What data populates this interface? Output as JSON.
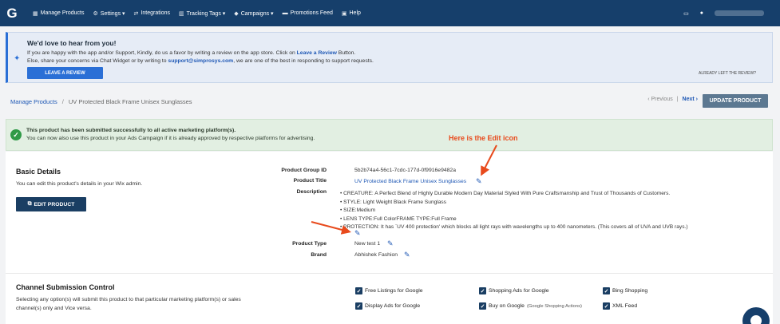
{
  "nav": {
    "logo": "G",
    "items": [
      {
        "label": "Manage Products",
        "icon": "grid-icon",
        "glyph": "▦"
      },
      {
        "label": "Settings ▾",
        "icon": "gear-icon",
        "glyph": "⚙"
      },
      {
        "label": "Integrations",
        "icon": "integration-icon",
        "glyph": "⇄"
      },
      {
        "label": "Tracking Tags ▾",
        "icon": "chart-icon",
        "glyph": "▥"
      },
      {
        "label": "Campaigns ▾",
        "icon": "tag-icon",
        "glyph": "◆"
      },
      {
        "label": "Promotions Feed",
        "icon": "ticket-icon",
        "glyph": "▬"
      },
      {
        "label": "Help",
        "icon": "help-icon",
        "glyph": "▣"
      }
    ]
  },
  "review": {
    "title": "We'd love to hear from you!",
    "line1_pre": "If you are happy with the app and/or Support, Kindly, do us a favor by writing a review on the app store. Click on ",
    "line1_link": "Leave a Review",
    "line1_post": " Button.",
    "line2_pre": "Else, share your concerns via Chat Widget or by writing to ",
    "line2_email": "support@simprosys.com",
    "line2_post": ", we are one of the best in responding to support requests.",
    "button": "LEAVE A REVIEW",
    "already": "ALREADY LEFT THE REVIEW?"
  },
  "breadcrumb": {
    "root": "Manage Products",
    "sep": "/",
    "current": "UV Protected Black Frame Unisex Sunglasses",
    "previous": "‹ Previous",
    "divider": "|",
    "next": "Next ›",
    "update_button": "UPDATE PRODUCT"
  },
  "success": {
    "line1": "This product has been submitted successfully to all active marketing platform(s).",
    "line2": "You can now also use this product in your Ads Campaign if it is already approved by respective platforms for advertising."
  },
  "annotation": "Here is the Edit icon",
  "basic": {
    "title": "Basic Details",
    "text": "You can edit this product's details in your Wix admin.",
    "button": "EDIT PRODUCT"
  },
  "details": {
    "group_id_label": "Product Group ID",
    "group_id": "5b2b74a4-56c1-7cdc-177d-0f9916e9482a",
    "title_label": "Product Title",
    "title": "UV Protected Black Frame Unisex Sunglasses",
    "description_label": "Description",
    "description": [
      "CREATURE: A Perfect Blend of Highly Durable Modern Day Material Styled With Pure Craftsmanship and Trust of Thousands of Customers.",
      "STYLE: Light Weight Black Frame Sunglass",
      "SIZE:Medium",
      "LENS TYPE:Full ColorFRAME TYPE:Full Frame",
      "PROTECTION: It has `UV 400 protection' which blocks all light rays with wavelengths up to 400 nanometers. (This covers all of UVA and UVB rays.)"
    ],
    "type_label": "Product Type",
    "type": "New test 1",
    "brand_label": "Brand",
    "brand": "Abhishek Fashion"
  },
  "channel": {
    "title": "Channel Submission Control",
    "text1": "Selecting any option(s) will submit this product to that particular marketing platform(s) or sales",
    "text2": "channel(s) only and Vice versa.",
    "options": [
      {
        "label": "Free Listings for Google",
        "checked": true
      },
      {
        "label": "Shopping Ads for Google",
        "checked": true
      },
      {
        "label": "Bing Shopping",
        "checked": true
      },
      {
        "label": "Display Ads for Google",
        "checked": true
      },
      {
        "label": "Buy on Google",
        "sub": "(Google Shopping Actions)",
        "checked": true
      },
      {
        "label": "XML Feed",
        "checked": true
      }
    ]
  },
  "colors": {
    "nav": "#163f6b",
    "accent": "#2a6fd6",
    "annotation": "#e84a1c",
    "success": "#2f9a47"
  }
}
